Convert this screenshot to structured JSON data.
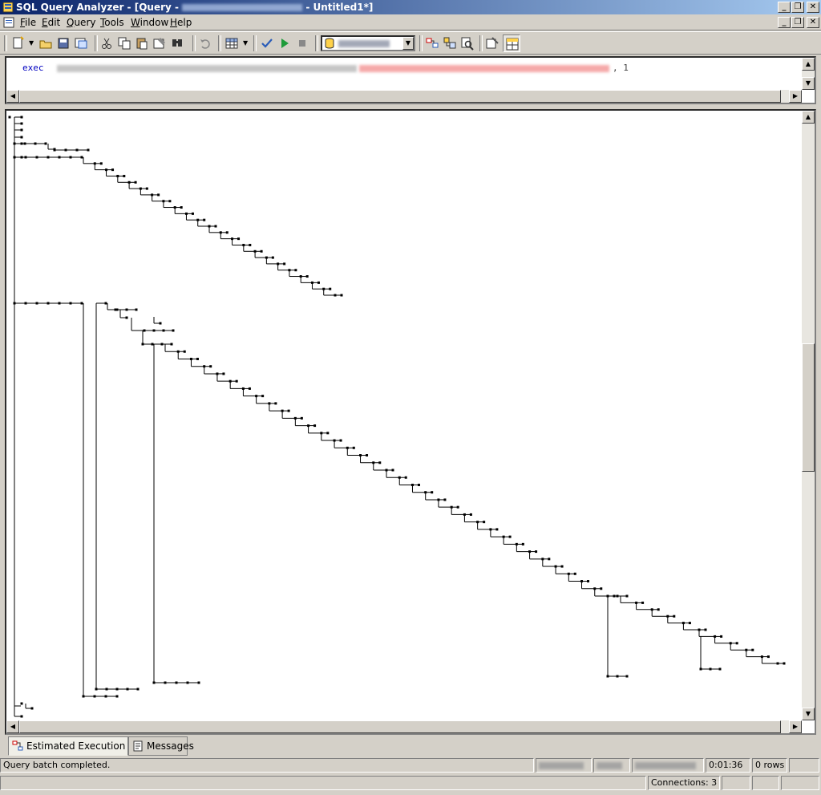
{
  "window": {
    "app_title": "SQL Query Analyzer - [Query -",
    "doc_title": "- Untitled1*]",
    "controls": [
      "_",
      "❐",
      "✕"
    ]
  },
  "menu": [
    {
      "label": "File",
      "accel": "F"
    },
    {
      "label": "Edit",
      "accel": "E"
    },
    {
      "label": "Query",
      "accel": "Q"
    },
    {
      "label": "Tools",
      "accel": "T"
    },
    {
      "label": "Window",
      "accel": "W"
    },
    {
      "label": "Help",
      "accel": "H"
    }
  ],
  "editor": {
    "keyword": "exec",
    "suffix": ", 1"
  },
  "tabs": {
    "plan": "Estimated Execution Plan",
    "messages": "Messages"
  },
  "status": {
    "message": "Query batch completed.",
    "elapsed": "0:01:36",
    "rows": "0 rows",
    "connections": "Connections: 3"
  }
}
